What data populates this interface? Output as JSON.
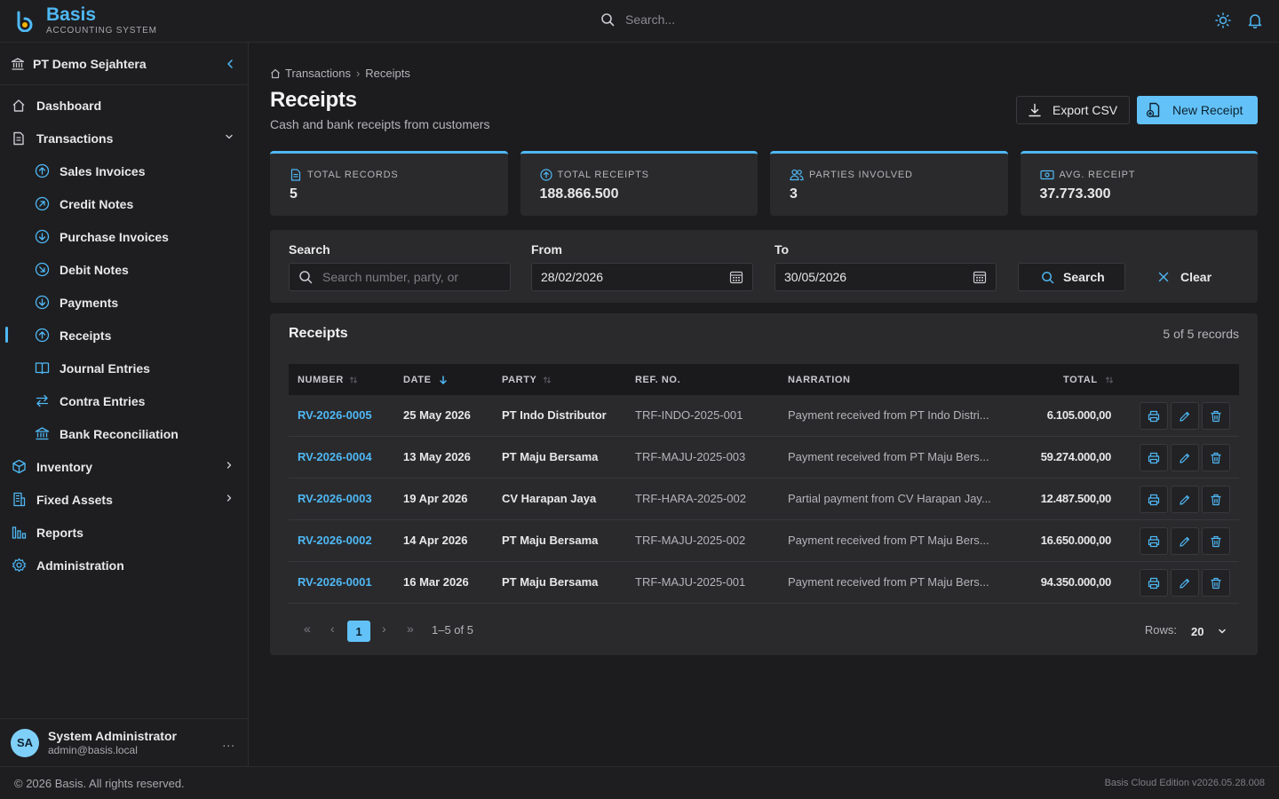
{
  "app": {
    "name": "Basis",
    "subtitle": "ACCOUNTING SYSTEM",
    "search_placeholder": "Search...",
    "accent": "#4fb8f5"
  },
  "sidebar": {
    "company": "PT Demo Sejahtera",
    "items": [
      {
        "label": "Dashboard",
        "icon": "home-icon"
      },
      {
        "label": "Transactions",
        "icon": "document-icon",
        "expanded": true
      },
      {
        "label": "Sales Invoices",
        "icon": "arrow-up-circle-icon"
      },
      {
        "label": "Credit Notes",
        "icon": "arrow-up-right-circle-icon"
      },
      {
        "label": "Purchase Invoices",
        "icon": "arrow-down-circle-icon"
      },
      {
        "label": "Debit Notes",
        "icon": "arrow-down-right-circle-icon"
      },
      {
        "label": "Payments",
        "icon": "arrow-down-circle-icon"
      },
      {
        "label": "Receipts",
        "icon": "arrow-up-circle-icon",
        "active": true
      },
      {
        "label": "Journal Entries",
        "icon": "book-icon"
      },
      {
        "label": "Contra Entries",
        "icon": "swap-icon"
      },
      {
        "label": "Bank Reconciliation",
        "icon": "bank-icon"
      },
      {
        "label": "Inventory",
        "icon": "box-icon"
      },
      {
        "label": "Fixed Assets",
        "icon": "building-icon"
      },
      {
        "label": "Reports",
        "icon": "chart-icon"
      },
      {
        "label": "Administration",
        "icon": "gear-icon"
      }
    ],
    "user": {
      "initials": "SA",
      "name": "System Administrator",
      "email": "admin@basis.local",
      "more": "..."
    }
  },
  "breadcrumb": {
    "parent": "Transactions",
    "separator": "›",
    "current": "Receipts"
  },
  "page": {
    "title": "Receipts",
    "subtitle": "Cash and bank receipts from customers",
    "export_label": "Export CSV",
    "new_label": "New Receipt"
  },
  "stats": [
    {
      "label": "TOTAL RECORDS",
      "value": "5",
      "icon": "document-icon"
    },
    {
      "label": "TOTAL RECEIPTS",
      "value": "188.866.500",
      "icon": "arrow-up-circle-icon"
    },
    {
      "label": "PARTIES INVOLVED",
      "value": "3",
      "icon": "users-icon"
    },
    {
      "label": "AVG. RECEIPT",
      "value": "37.773.300",
      "icon": "cash-icon"
    }
  ],
  "filters": {
    "search_label": "Search",
    "search_placeholder": "Search number, party, or",
    "from_label": "From",
    "from_value": "28/02/2026",
    "to_label": "To",
    "to_value": "30/05/2026",
    "search_button": "Search",
    "clear_button": "Clear"
  },
  "table": {
    "title": "Receipts",
    "count": "5 of 5 records",
    "columns": [
      "NUMBER",
      "DATE",
      "PARTY",
      "REF. NO.",
      "NARRATION",
      "TOTAL"
    ],
    "rows": [
      {
        "number": "RV-2026-0005",
        "date": "25 May 2026",
        "party": "PT Indo Distributor",
        "ref": "TRF-INDO-2025-001",
        "narration": "Payment received from PT Indo Distri...",
        "total": "6.105.000,00"
      },
      {
        "number": "RV-2026-0004",
        "date": "13 May 2026",
        "party": "PT Maju Bersama",
        "ref": "TRF-MAJU-2025-003",
        "narration": "Payment received from PT Maju Bers...",
        "total": "59.274.000,00"
      },
      {
        "number": "RV-2026-0003",
        "date": "19 Apr 2026",
        "party": "CV Harapan Jaya",
        "ref": "TRF-HARA-2025-002",
        "narration": "Partial payment from CV Harapan Jay...",
        "total": "12.487.500,00"
      },
      {
        "number": "RV-2026-0002",
        "date": "14 Apr 2026",
        "party": "PT Maju Bersama",
        "ref": "TRF-MAJU-2025-002",
        "narration": "Payment received from PT Maju Bers...",
        "total": "16.650.000,00"
      },
      {
        "number": "RV-2026-0001",
        "date": "16 Mar 2026",
        "party": "PT Maju Bersama",
        "ref": "TRF-MAJU-2025-001",
        "narration": "Payment received from PT Maju Bers...",
        "total": "94.350.000,00"
      }
    ]
  },
  "pagination": {
    "first": "«",
    "prev": "‹",
    "current": "1",
    "next": "›",
    "last": "»",
    "info": "1–5 of 5",
    "rows_label": "Rows:",
    "rows_value": "20"
  },
  "footer": {
    "copyright": "© 2026 Basis. All rights reserved.",
    "version": "Basis Cloud Edition v2026.05.28.008"
  }
}
